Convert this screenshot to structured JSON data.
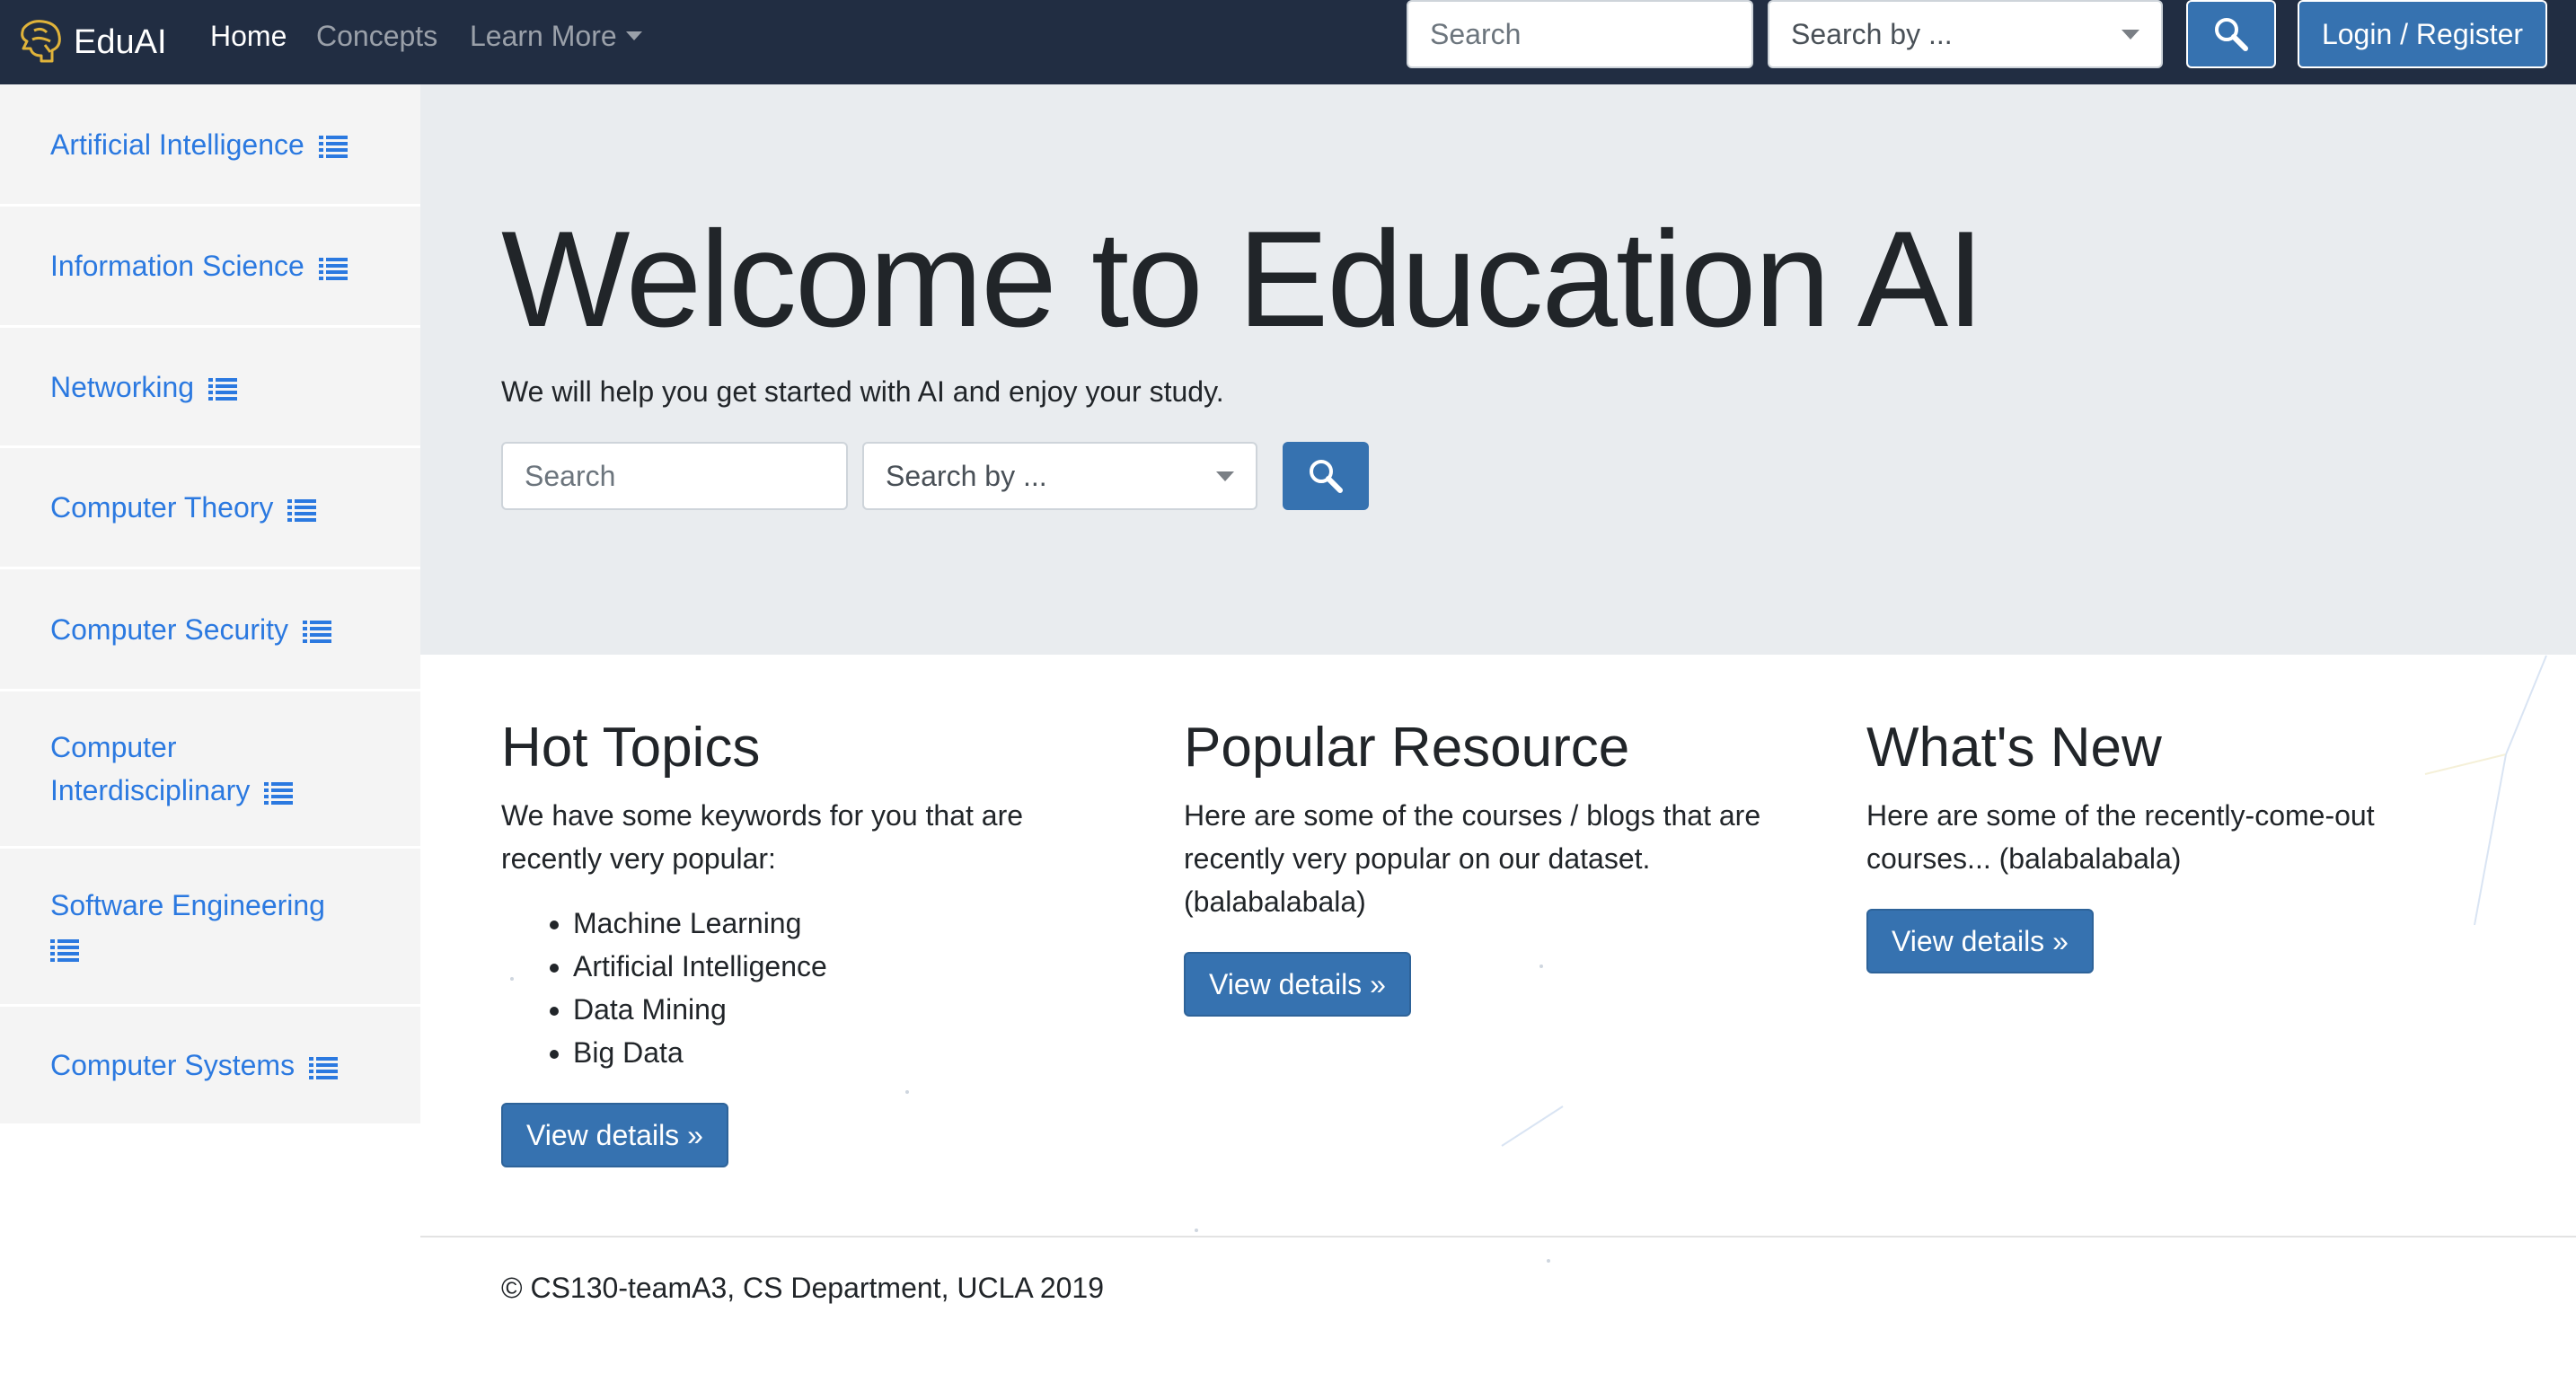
{
  "navbar": {
    "brand": "EduAI",
    "links": [
      "Home",
      "Concepts",
      "Learn More"
    ],
    "search_placeholder": "Search",
    "search_by": "Search by ...",
    "login": "Login / Register",
    "search_icon": "magnifier-icon",
    "logo_icon": "brain-logo-icon",
    "dropdown_icon": "caret-down-icon"
  },
  "sidebar": {
    "items": [
      {
        "label": "Artificial Intelligence",
        "icon": "list-icon"
      },
      {
        "label": "Information Science",
        "icon": "list-icon"
      },
      {
        "label": "Networking",
        "icon": "list-icon"
      },
      {
        "label": "Computer Theory",
        "icon": "list-icon"
      },
      {
        "label": "Computer Security",
        "icon": "list-icon"
      },
      {
        "label": "Computer Interdisciplinary",
        "icon": "list-icon"
      },
      {
        "label": "Software Engineering",
        "icon": "list-icon"
      },
      {
        "label": "Computer Systems",
        "icon": "list-icon"
      }
    ]
  },
  "hero": {
    "title": "Welcome to Education AI",
    "subtitle": "We will help you get started with AI and enjoy your study.",
    "search_placeholder": "Search",
    "search_by": "Search by ..."
  },
  "columns": [
    {
      "title": "Hot Topics",
      "text": "We have some keywords for you that are recently very popular:",
      "items": [
        "Machine Learning",
        "Artificial Intelligence",
        "Data Mining",
        "Big Data"
      ],
      "button": "View details »"
    },
    {
      "title": "Popular Resource",
      "text": "Here are some of the courses / blogs that are recently very popular on our dataset. (balabalabala)",
      "button": "View details »"
    },
    {
      "title": "What's New",
      "text": "Here are some of the recently-come-out courses... (balabalabala)",
      "button": "View details »"
    }
  ],
  "footer": "© CS130-teamA3, CS Department, UCLA 2019",
  "colors": {
    "navbar": "#212d42",
    "primary_button": "#3672b0",
    "sidebar_link": "#2b79e0",
    "jumbotron": "#e9ecef",
    "sidebar_bg": "#f4f4f4"
  }
}
